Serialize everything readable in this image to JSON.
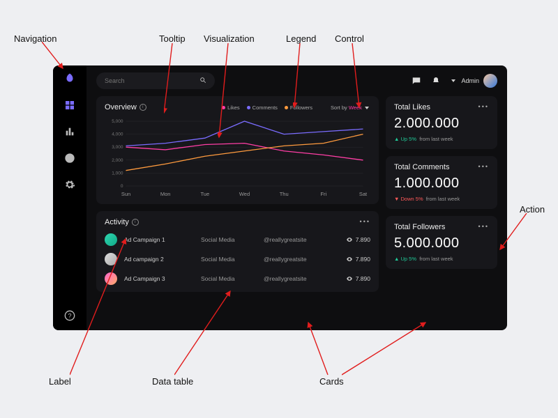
{
  "annotations": {
    "nav": "Navigation",
    "tooltip": "Tooltip",
    "visualization": "Visualization",
    "legend": "Legend",
    "control": "Control",
    "action": "Action",
    "label": "Label",
    "datatable": "Data table",
    "cards": "Cards"
  },
  "search": {
    "placeholder": "Search"
  },
  "header": {
    "admin_label": "Admin"
  },
  "overview": {
    "title": "Overview",
    "legend": {
      "likes": "Likes",
      "comments": "Comments",
      "followers": "Followers"
    },
    "sort_label": "Sort by ",
    "sort_value": "Week"
  },
  "activity": {
    "title": "Activity",
    "rows": [
      {
        "name": "Ad Campaign 1",
        "type": "Social Media",
        "handle": "@reallygreatsite",
        "views": "7.890"
      },
      {
        "name": "Ad campaign 2",
        "type": "Social Media",
        "handle": "@reallygreatsite",
        "views": "7.890"
      },
      {
        "name": "Ad Campaign 3",
        "type": "Social Media",
        "handle": "@reallygreatsite",
        "views": "7.890"
      }
    ]
  },
  "stats": {
    "likes": {
      "title": "Total Likes",
      "value": "2.000.000",
      "dir": "up",
      "delta": "Up 5%",
      "from": "from last week"
    },
    "comments": {
      "title": "Total Comments",
      "value": "1.000.000",
      "dir": "down",
      "delta": "Down 5%",
      "from": "from last week"
    },
    "followers": {
      "title": "Total Followers",
      "value": "5.000.000",
      "dir": "up",
      "delta": "Up 5%",
      "from": "from last week"
    }
  },
  "chart_data": {
    "type": "line",
    "title": "Overview",
    "xlabel": "",
    "ylabel": "",
    "ylim": [
      0,
      5000
    ],
    "yticks": [
      0,
      1000,
      2000,
      3000,
      4000,
      5000
    ],
    "ytick_labels": [
      "0",
      "1,000",
      "2,000",
      "3,000",
      "4,000",
      "5,000"
    ],
    "categories": [
      "Sun",
      "Mon",
      "Tue",
      "Wed",
      "Thu",
      "Fri",
      "Sat"
    ],
    "series": [
      {
        "name": "Likes",
        "color": "#ff3ea5",
        "values": [
          3000,
          2800,
          3200,
          3300,
          2700,
          2400,
          2000
        ]
      },
      {
        "name": "Comments",
        "color": "#7a6cff",
        "values": [
          3100,
          3300,
          3700,
          5000,
          4000,
          4200,
          4400
        ]
      },
      {
        "name": "Followers",
        "color": "#ff9b3e",
        "values": [
          1200,
          1700,
          2300,
          2700,
          3100,
          3300,
          4000
        ]
      }
    ]
  }
}
